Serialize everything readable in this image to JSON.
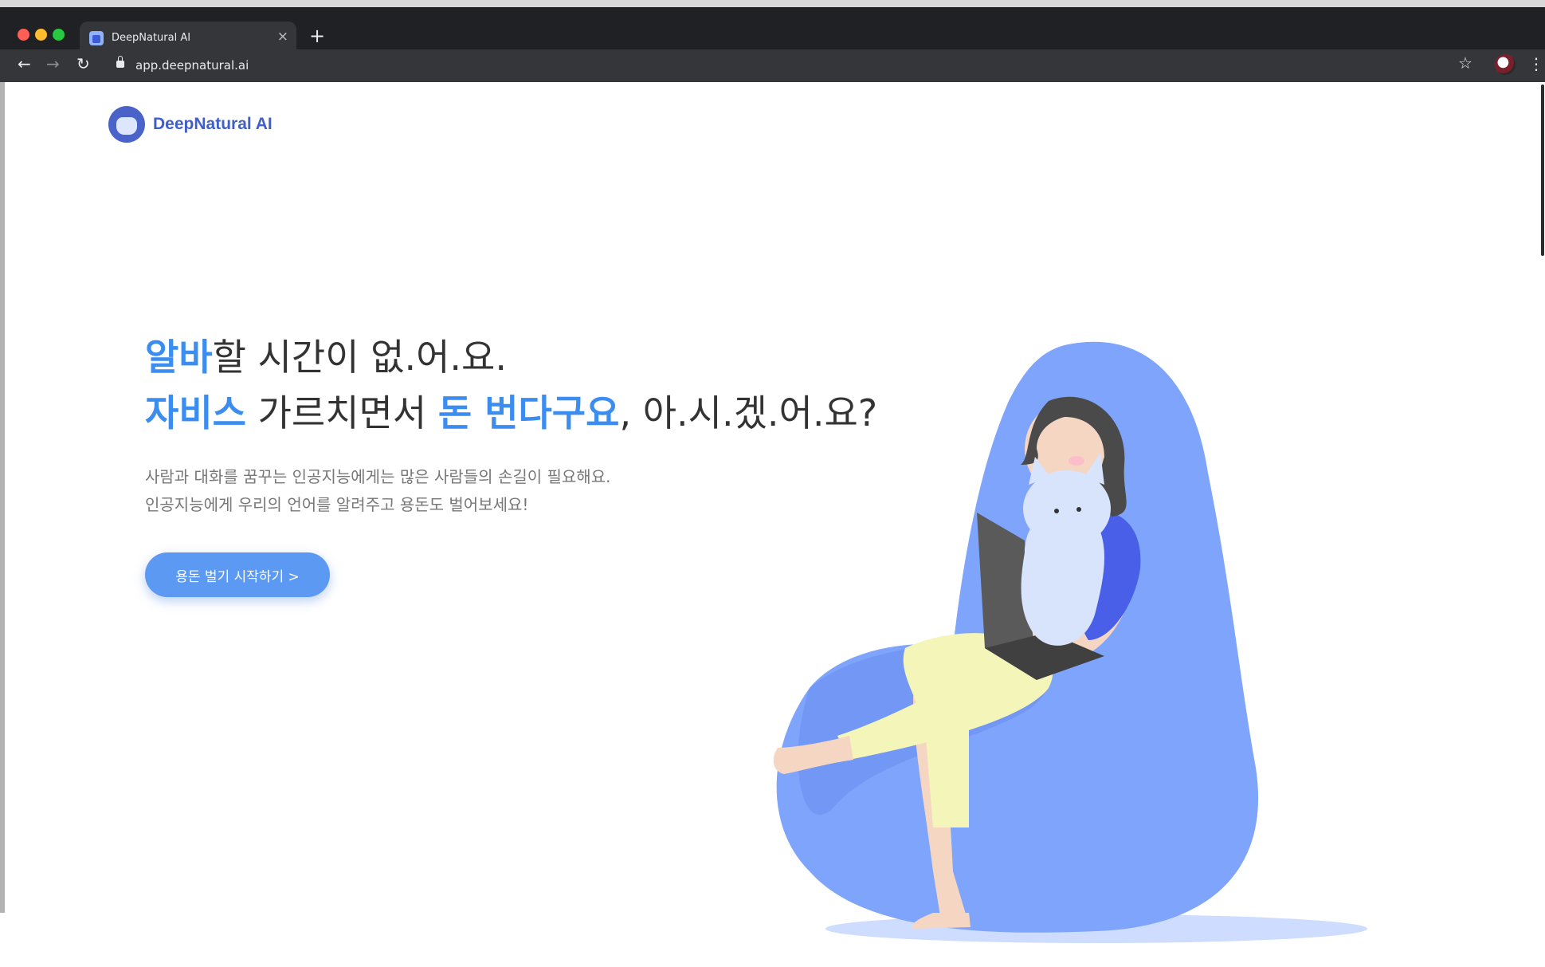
{
  "browser": {
    "tab_title": "DeepNatural AI",
    "url": "app.deepnatural.ai"
  },
  "brand": {
    "name": "DeepNatural  AI",
    "accent_color": "#3b8ef0",
    "button_color": "#5b99f2"
  },
  "hero": {
    "line1_highlight": "알바",
    "line1_rest": "할 시간이 없.어.요.",
    "line2_highlight1": "자비스",
    "line2_middle": " 가르치면서 ",
    "line2_highlight2": "돈 번다구요",
    "line2_rest": ", 아.시.겠.어.요?",
    "sub_line1": "사람과 대화를 꿈꾸는 인공지능에게는 많은 사람들의 손길이 필요해요.",
    "sub_line2": "인공지능에게 우리의 언어를 알려주고 용돈도 벌어보세요!",
    "cta_label": "용돈 벌기 시작하기 >"
  },
  "icons": {
    "back": "←",
    "forward": "→",
    "reload": "↻",
    "close": "×",
    "new_tab": "+",
    "star": "☆",
    "menu": "⋮"
  }
}
